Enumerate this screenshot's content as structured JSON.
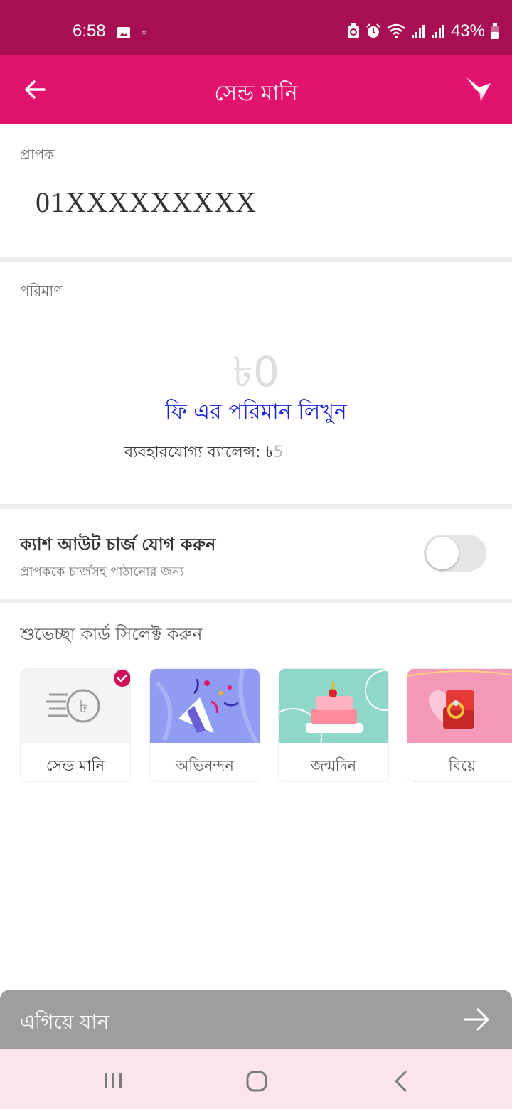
{
  "status_bar": {
    "time": "6:58",
    "more_indicator": "»",
    "battery_percent": "43%",
    "icons": [
      "gallery-icon",
      "battery-saver-icon",
      "alarm-icon",
      "wifi-icon",
      "signal-icon",
      "signal-icon",
      "battery-icon"
    ]
  },
  "app_bar": {
    "title": "সেন্ড মানি",
    "back_icon": "arrow-left-icon",
    "right_icon": "bird-icon"
  },
  "recipient": {
    "label": "প্রাপক",
    "number": "01XXXXXXXXX"
  },
  "amount": {
    "label": "পরিমাণ",
    "value": "৳0",
    "fee_prompt": "ফি এর পরিমান লিখুন",
    "balance_label": "ব্যবহারযোগ্য ব্যালেন্স: ৳",
    "balance_suffix": "5"
  },
  "cash_out_charge": {
    "title": "ক্যাশ আউট চার্জ যোগ করুন",
    "subtitle": "প্রাপককে চার্জসহ পাঠানোর জন্য",
    "enabled": false
  },
  "greeting_cards": {
    "title": "শুভেচ্ছা কার্ড সিলেক্ট করুন",
    "cards": [
      {
        "label": "সেন্ড মানি",
        "icon": "send-money-icon",
        "selected": true
      },
      {
        "label": "অভিনন্দন",
        "icon": "party-popper-icon",
        "selected": false
      },
      {
        "label": "জন্মদিন",
        "icon": "birthday-cake-icon",
        "selected": false
      },
      {
        "label": "বিয়ে",
        "icon": "wedding-ring-icon",
        "selected": false
      }
    ]
  },
  "continue_button": {
    "label": "এগিয়ে যান",
    "icon": "arrow-right-icon"
  },
  "colors": {
    "status_bar": "#a80f52",
    "brand_pink": "#e2136e",
    "fee_prompt_blue": "#1a23d6",
    "continue_disabled": "#9e9e9e",
    "nav_bar": "#fce4ec"
  },
  "nav_bar": {
    "icons": [
      "recent-apps-icon",
      "home-icon",
      "back-icon"
    ]
  }
}
